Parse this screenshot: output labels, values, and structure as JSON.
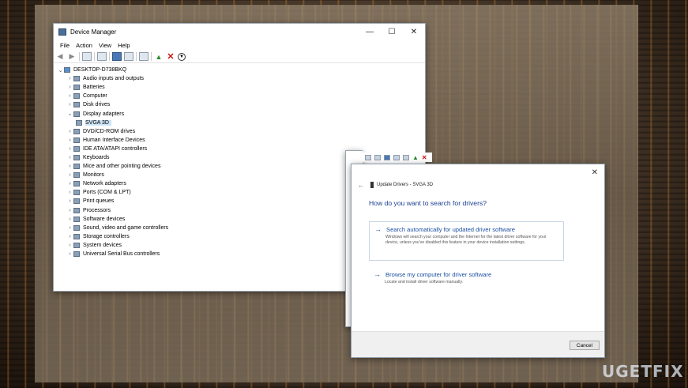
{
  "device_manager": {
    "title": "Device Manager",
    "window_controls": [
      "—",
      "☐",
      "✕"
    ],
    "menu": [
      "File",
      "Action",
      "View",
      "Help"
    ],
    "root": "DESKTOP-D738BKQ",
    "nodes": [
      {
        "label": "Audio inputs and outputs",
        "expanded": false
      },
      {
        "label": "Batteries",
        "expanded": false
      },
      {
        "label": "Computer",
        "expanded": false
      },
      {
        "label": "Disk drives",
        "expanded": false
      },
      {
        "label": "Display adapters",
        "expanded": true
      },
      {
        "label": "SVGA 3D",
        "child": true,
        "selected": true
      },
      {
        "label": "DVD/CD-ROM drives",
        "expanded": false
      },
      {
        "label": "Human Interface Devices",
        "expanded": false
      },
      {
        "label": "IDE ATA/ATAPI controllers",
        "expanded": false
      },
      {
        "label": "Keyboards",
        "expanded": false
      },
      {
        "label": "Mice and other pointing devices",
        "expanded": false
      },
      {
        "label": "Monitors",
        "expanded": false
      },
      {
        "label": "Network adapters",
        "expanded": false
      },
      {
        "label": "Ports (COM & LPT)",
        "expanded": false
      },
      {
        "label": "Print queues",
        "expanded": false
      },
      {
        "label": "Processors",
        "expanded": false
      },
      {
        "label": "Software devices",
        "expanded": false
      },
      {
        "label": "Sound, video and game controllers",
        "expanded": false
      },
      {
        "label": "Storage controllers",
        "expanded": false
      },
      {
        "label": "System devices",
        "expanded": false
      },
      {
        "label": "Universal Serial Bus controllers",
        "expanded": false
      }
    ]
  },
  "update_drivers": {
    "header": "Update Drivers - SVGA 3D",
    "close": "✕",
    "question": "How do you want to search for drivers?",
    "option1": {
      "title": "Search automatically for updated driver software",
      "desc": "Windows will search your computer and the Internet for the latest driver software for your device, unless you've disabled this feature in your device installation settings."
    },
    "option2": {
      "title": "Browse my computer for driver software",
      "desc": "Locate and install driver software manually."
    },
    "cancel": "Cancel"
  },
  "watermark": {
    "a": "U",
    "b": "G",
    "c": "ET",
    "d": "FIX"
  }
}
